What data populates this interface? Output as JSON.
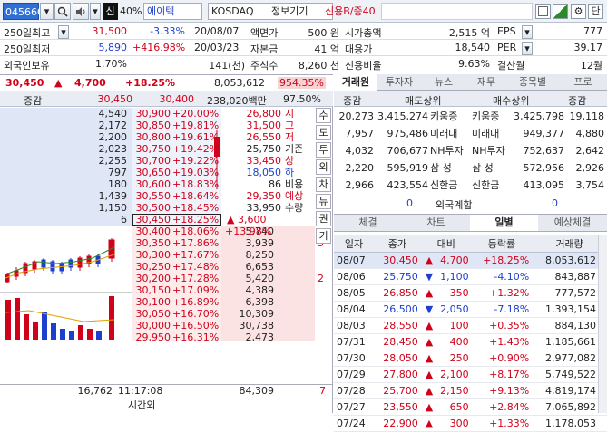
{
  "topbar": {
    "code": "045660",
    "margin": "40%",
    "shin": "신",
    "company": "에이텍",
    "market": "KOSDAQ",
    "sector": "정보기기",
    "credit": "신용B/증40",
    "right_icon": "단"
  },
  "info": {
    "row1": {
      "label": "250일최고",
      "price": "31,500",
      "pct": "-3.33%",
      "date": "20/08/07",
      "k1": "액면가",
      "v1": "500 원",
      "k2": "시가총액",
      "v2": "2,515 억",
      "k3": "EPS",
      "v3": "777"
    },
    "row2": {
      "label": "250일최저",
      "price": "5,890",
      "pct": "+416.98%",
      "date": "20/03/23",
      "k1": "자본금",
      "v1": "41 억",
      "k2": "대용가",
      "v2": "18,540",
      "k3": "PER",
      "v3": "39.17"
    },
    "row3": {
      "label": "외국인보유",
      "price": "1.70%",
      "qty": "141(천)",
      "k1": "주식수",
      "v1": "8,260 천",
      "k2": "신용비율",
      "v2": "9.63%",
      "k3": "결산월",
      "v3": "12월"
    }
  },
  "pricebar": {
    "price": "30,450",
    "arrow": "▲",
    "change": "4,700",
    "pct": "+18.25%",
    "volume": "8,053,612",
    "vol_ratio": "954.35%"
  },
  "orderbook": {
    "header": {
      "label": "증감",
      "ask_total": "30,450",
      "bid_total": "30,400",
      "amount": "238,020백만",
      "ratio": "97.50%"
    },
    "asks": [
      {
        "qty": "4,540",
        "price": "30,900",
        "pct": "+20.00%"
      },
      {
        "qty": "2,172",
        "price": "30,850",
        "pct": "+19.81%"
      },
      {
        "qty": "2,200",
        "price": "30,800",
        "pct": "+19.61%"
      },
      {
        "qty": "2,023",
        "price": "30,750",
        "pct": "+19.42%"
      },
      {
        "qty": "2,255",
        "price": "30,700",
        "pct": "+19.22%"
      },
      {
        "qty": "797",
        "price": "30,650",
        "pct": "+19.03%"
      },
      {
        "qty": "180",
        "price": "30,600",
        "pct": "+18.83%"
      },
      {
        "qty": "1,439",
        "price": "30,550",
        "pct": "+18.64%"
      },
      {
        "qty": "1,150",
        "price": "30,500",
        "pct": "+18.45%"
      },
      {
        "qty": "6",
        "price": "30,450",
        "pct": "+18.25%"
      }
    ],
    "bids": [
      {
        "price": "30,400",
        "pct": "+18.06%",
        "qty": "5,740",
        "chg": ""
      },
      {
        "price": "30,350",
        "pct": "+17.86%",
        "qty": "3,939",
        "chg": "5"
      },
      {
        "price": "30,300",
        "pct": "+17.67%",
        "qty": "8,250",
        "chg": ""
      },
      {
        "price": "30,250",
        "pct": "+17.48%",
        "qty": "6,653",
        "chg": ""
      },
      {
        "price": "30,200",
        "pct": "+17.28%",
        "qty": "5,420",
        "chg": "2"
      },
      {
        "price": "30,150",
        "pct": "+17.09%",
        "qty": "4,389",
        "chg": ""
      },
      {
        "price": "30,100",
        "pct": "+16.89%",
        "qty": "6,398",
        "chg": ""
      },
      {
        "price": "30,050",
        "pct": "+16.70%",
        "qty": "10,309",
        "chg": ""
      },
      {
        "price": "30,000",
        "pct": "+16.50%",
        "qty": "30,738",
        "chg": ""
      },
      {
        "price": "29,950",
        "pct": "+16.31%",
        "qty": "2,473",
        "chg": ""
      }
    ],
    "stats": [
      {
        "val": "26,800",
        "key": "시"
      },
      {
        "val": "31,500",
        "key": "고"
      },
      {
        "val": "26,550",
        "key": "저"
      },
      {
        "val": "25,750",
        "key": "기준"
      },
      {
        "val": "33,450",
        "key": "상"
      },
      {
        "val": "18,050",
        "key": "하"
      },
      {
        "val": "86",
        "key": "비용"
      },
      {
        "val": "29,350",
        "key": "예상"
      },
      {
        "val": "33,950",
        "key": "수량"
      }
    ],
    "expected": {
      "arrow": "▲",
      "change": "3,600",
      "pct": "+13.98%"
    },
    "footer": {
      "ask_total": "16,762",
      "time": "11:17:08",
      "time_label": "시간외",
      "bid_total": "84,309",
      "chg": "7"
    }
  },
  "side_tabs": [
    "수",
    "도",
    "투",
    "외",
    "차",
    "뉴",
    "권",
    "기"
  ],
  "right_tabs": [
    "거래원",
    "투자자",
    "뉴스",
    "재무",
    "종목별",
    "프로"
  ],
  "brokers": {
    "headers": [
      "증감",
      "매도상위",
      "매수상위",
      "증감"
    ],
    "rows": [
      {
        "c1": "20,273",
        "s_qty": "3,415,274",
        "s_name": "키움증",
        "b_name": "키움증",
        "b_qty": "3,425,798",
        "c2": "19,118"
      },
      {
        "c1": "7,957",
        "s_qty": "975,486",
        "s_name": "미래대",
        "b_name": "미래대",
        "b_qty": "949,377",
        "c2": "4,880"
      },
      {
        "c1": "4,032",
        "s_qty": "706,677",
        "s_name": "NH투자",
        "b_name": "NH투자",
        "b_qty": "752,637",
        "c2": "2,642"
      },
      {
        "c1": "2,220",
        "s_qty": "595,919",
        "s_name": "삼 성",
        "b_name": "삼 성",
        "b_qty": "572,956",
        "c2": "2,926"
      },
      {
        "c1": "2,966",
        "s_qty": "423,554",
        "s_name": "신한금",
        "b_name": "신한금",
        "b_qty": "413,095",
        "c2": "3,754"
      }
    ],
    "foreign": {
      "c1": "0",
      "label": "외국계합",
      "c2": "0"
    }
  },
  "lower_tabs": [
    "체결",
    "차트",
    "일별",
    "예상체결"
  ],
  "daily": {
    "headers": [
      "일자",
      "종가",
      "대비",
      "등락률",
      "거래량"
    ],
    "rows": [
      {
        "date": "08/07",
        "close": "30,450",
        "dir": "▲",
        "chg": "4,700",
        "pct": "+18.25%",
        "vol": "8,053,612",
        "color": "red"
      },
      {
        "date": "08/06",
        "close": "25,750",
        "dir": "▼",
        "chg": "1,100",
        "pct": "-4.10%",
        "vol": "843,887",
        "color": "blue"
      },
      {
        "date": "08/05",
        "close": "26,850",
        "dir": "▲",
        "chg": "350",
        "pct": "+1.32%",
        "vol": "777,572",
        "color": "red"
      },
      {
        "date": "08/04",
        "close": "26,500",
        "dir": "▼",
        "chg": "2,050",
        "pct": "-7.18%",
        "vol": "1,393,154",
        "color": "blue"
      },
      {
        "date": "08/03",
        "close": "28,550",
        "dir": "▲",
        "chg": "100",
        "pct": "+0.35%",
        "vol": "884,130",
        "color": "red"
      },
      {
        "date": "07/31",
        "close": "28,450",
        "dir": "▲",
        "chg": "400",
        "pct": "+1.43%",
        "vol": "1,185,661",
        "color": "red"
      },
      {
        "date": "07/30",
        "close": "28,050",
        "dir": "▲",
        "chg": "250",
        "pct": "+0.90%",
        "vol": "2,977,082",
        "color": "red"
      },
      {
        "date": "07/29",
        "close": "27,800",
        "dir": "▲",
        "chg": "2,100",
        "pct": "+8.17%",
        "vol": "5,749,522",
        "color": "red"
      },
      {
        "date": "07/28",
        "close": "25,700",
        "dir": "▲",
        "chg": "2,150",
        "pct": "+9.13%",
        "vol": "4,819,174",
        "color": "red"
      },
      {
        "date": "07/27",
        "close": "23,550",
        "dir": "▲",
        "chg": "650",
        "pct": "+2.84%",
        "vol": "7,065,892",
        "color": "red"
      },
      {
        "date": "07/24",
        "close": "22,900",
        "dir": "▲",
        "chg": "300",
        "pct": "+1.33%",
        "vol": "1,178,053",
        "color": "red"
      }
    ]
  },
  "colors": {
    "up": "#d0021b",
    "down": "#1d3fcf",
    "ask_bg": "#dfe7f7",
    "bid_bg": "#fbe3e3",
    "code_bg": "#2f6fd6"
  }
}
